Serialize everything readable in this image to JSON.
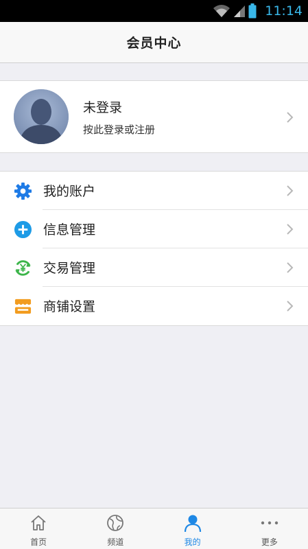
{
  "status_bar": {
    "time": "11:14"
  },
  "header": {
    "title": "会员中心"
  },
  "profile": {
    "name": "未登录",
    "subtitle": "按此登录或注册"
  },
  "menu": {
    "items": [
      {
        "label": "我的账户",
        "icon": "gear-icon",
        "color": "#1e7be6"
      },
      {
        "label": "信息管理",
        "icon": "plus-circle-icon",
        "color": "#1e9be6"
      },
      {
        "label": "交易管理",
        "icon": "yen-exchange-icon",
        "color": "#3cb54a"
      },
      {
        "label": "商铺设置",
        "icon": "shop-icon",
        "color": "#f29c1f"
      }
    ]
  },
  "tabs": [
    {
      "label": "首页",
      "icon": "home-icon"
    },
    {
      "label": "频道",
      "icon": "globe-icon"
    },
    {
      "label": "我的",
      "icon": "user-icon",
      "active": true
    },
    {
      "label": "更多",
      "icon": "more-icon"
    }
  ],
  "colors": {
    "accent": "#1e88e5",
    "background": "#efeff4"
  }
}
